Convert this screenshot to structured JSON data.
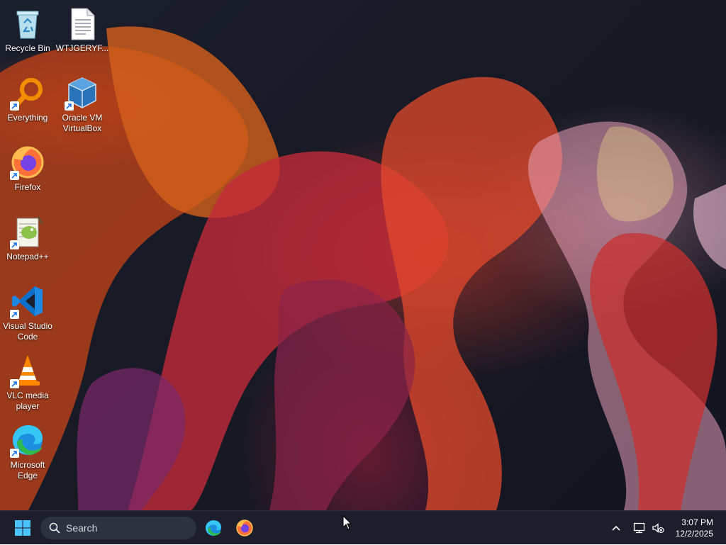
{
  "desktop": {
    "icons": [
      {
        "label": "Recycle Bin",
        "icon": "recycle-bin-icon"
      },
      {
        "label": "WTJGERYF...",
        "icon": "text-file-icon"
      },
      {
        "label": "Everything",
        "icon": "everything-search-icon"
      },
      {
        "label": "Oracle VM VirtualBox",
        "icon": "virtualbox-icon"
      },
      {
        "label": "Firefox",
        "icon": "firefox-icon"
      },
      {
        "label": "Notepad++",
        "icon": "notepadpp-icon"
      },
      {
        "label": "Visual Studio Code",
        "icon": "vscode-icon"
      },
      {
        "label": "VLC media player",
        "icon": "vlc-icon"
      },
      {
        "label": "Microsoft Edge",
        "icon": "edge-icon"
      }
    ]
  },
  "taskbar": {
    "search": {
      "placeholder": "Search"
    },
    "pinned": [
      {
        "icon": "edge-icon"
      },
      {
        "icon": "firefox-icon"
      }
    ],
    "tray": {
      "overflow_icon": "chevron-up-icon",
      "network_icon": "network-icon",
      "volume_icon": "volume-muted-icon"
    },
    "clock": {
      "time": "3:07 PM",
      "date": "12/2/2025"
    }
  },
  "colors": {
    "taskbar_bg": "#1c1f2b",
    "search_bg": "#2e3140",
    "windows_blue": "#4cc2ff"
  }
}
